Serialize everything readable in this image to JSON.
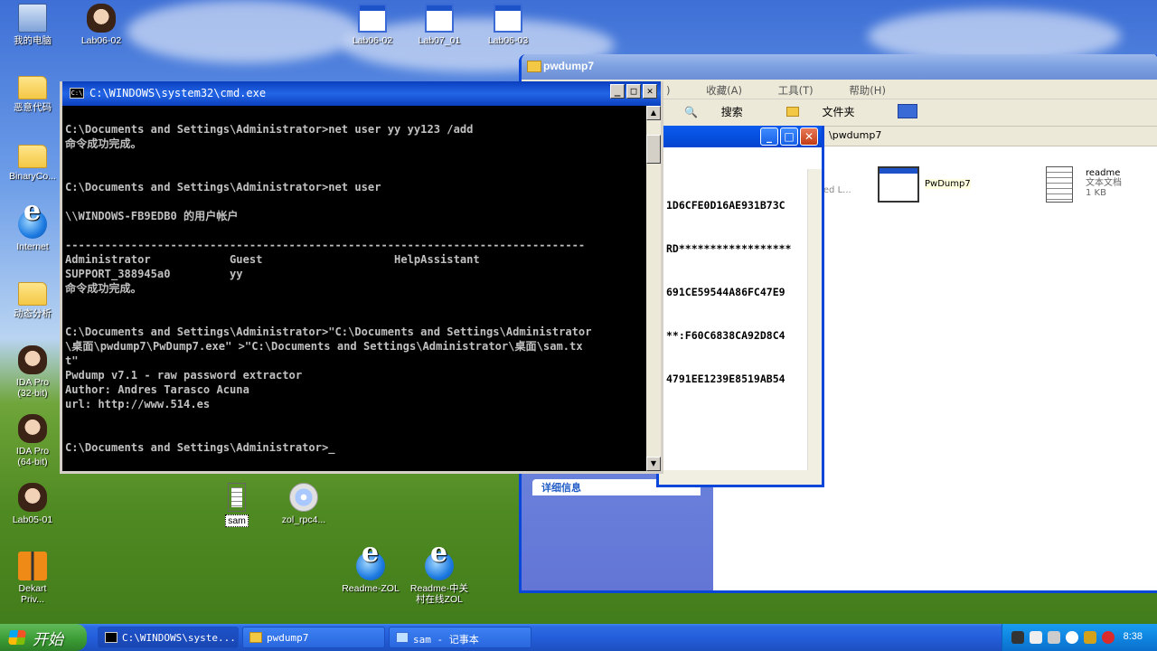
{
  "desktop": {
    "icons": [
      {
        "label": "我的电脑",
        "kind": "pc"
      },
      {
        "label": "Lab06-02",
        "kind": "face"
      },
      {
        "label": "恶意代码",
        "kind": "folder"
      },
      {
        "label": "BinaryCo...",
        "kind": "folder"
      },
      {
        "label": "Internet",
        "kind": "ie"
      },
      {
        "label": "动态分析",
        "kind": "folder"
      },
      {
        "label": "IDA Pro\n(32-bit)",
        "kind": "face"
      },
      {
        "label": "IDA Pro\n(64-bit)",
        "kind": "face"
      },
      {
        "label": "Lab05-01",
        "kind": "face"
      },
      {
        "label": "Dekart\nPriv...",
        "kind": "dekart"
      },
      {
        "label": "Lab06-02",
        "kind": "win"
      },
      {
        "label": "Lab07_01",
        "kind": "win"
      },
      {
        "label": "Lab06-03",
        "kind": "win"
      },
      {
        "label": "sam",
        "kind": "doc"
      },
      {
        "label": "zol_rpc4...",
        "kind": "disc"
      },
      {
        "label": "Readme-ZOL",
        "kind": "ie"
      },
      {
        "label": "Readme-中关\n村在线ZOL",
        "kind": "ie"
      }
    ]
  },
  "explorer": {
    "title": "pwdump7",
    "menu": [
      "收藏(A)",
      "工具(T)",
      "帮助(H)"
    ],
    "menu_fragment": ")",
    "toolbar": {
      "search": "搜索",
      "folders": "文件夹"
    },
    "address": "\\pwdump7",
    "details": "详细信息",
    "files": [
      {
        "name": "PwDump7"
      },
      {
        "name": "readme",
        "type": "文本文档",
        "size": "1 KB"
      }
    ],
    "partial_file": {
      "line1": "l",
      "line2": "red L..."
    }
  },
  "notepad": {
    "lines": [
      "1D6CFE0D16AE931B73C",
      "RD******************",
      "691CE59544A86FC47E9",
      "**:F60C6838CA92D8C4",
      "4791EE1239E8519AB54"
    ]
  },
  "cmd": {
    "title": "C:\\WINDOWS\\system32\\cmd.exe",
    "lines": [
      "",
      "C:\\Documents and Settings\\Administrator>net user yy yy123 /add",
      "命令成功完成。",
      "",
      "",
      "C:\\Documents and Settings\\Administrator>net user",
      "",
      "\\\\WINDOWS-FB9EDB0 的用户帐户",
      "",
      "-------------------------------------------------------------------------------",
      "Administrator            Guest                    HelpAssistant",
      "SUPPORT_388945a0         yy",
      "命令成功完成。",
      "",
      "",
      "C:\\Documents and Settings\\Administrator>\"C:\\Documents and Settings\\Administrator",
      "\\桌面\\pwdump7\\PwDump7.exe\" >\"C:\\Documents and Settings\\Administrator\\桌面\\sam.tx",
      "t\"",
      "Pwdump v7.1 - raw password extractor",
      "Author: Andres Tarasco Acuna",
      "url: http://www.514.es",
      "",
      "",
      "C:\\Documents and Settings\\Administrator>_"
    ]
  },
  "taskbar": {
    "start": "开始",
    "tasks": [
      {
        "label": "C:\\WINDOWS\\syste...",
        "icon": "cmd"
      },
      {
        "label": "pwdump7",
        "icon": "folder"
      },
      {
        "label": "sam - 记事本",
        "icon": "notepad"
      }
    ],
    "clock": "8:38"
  }
}
